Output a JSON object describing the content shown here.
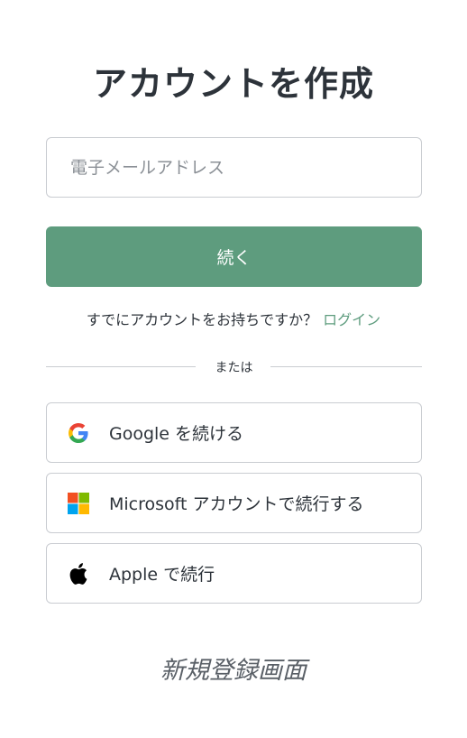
{
  "header": {
    "title": "アカウントを作成"
  },
  "form": {
    "email_placeholder": "電子メールアドレス",
    "continue_label": "続く"
  },
  "login": {
    "prompt": "すでにアカウントをお持ちですか？",
    "link_label": "ログイン"
  },
  "divider": {
    "text": "または"
  },
  "social": {
    "google_label": "Google を続ける",
    "microsoft_label": "Microsoft アカウントで続行する",
    "apple_label": "Apple で続行"
  },
  "footer": {
    "caption": "新規登録画面"
  },
  "colors": {
    "accent": "#5e9c7e",
    "text": "#2d333a",
    "border": "#c9ccd1"
  },
  "icons": {
    "google": "google-icon",
    "microsoft": "microsoft-icon",
    "apple": "apple-icon"
  }
}
